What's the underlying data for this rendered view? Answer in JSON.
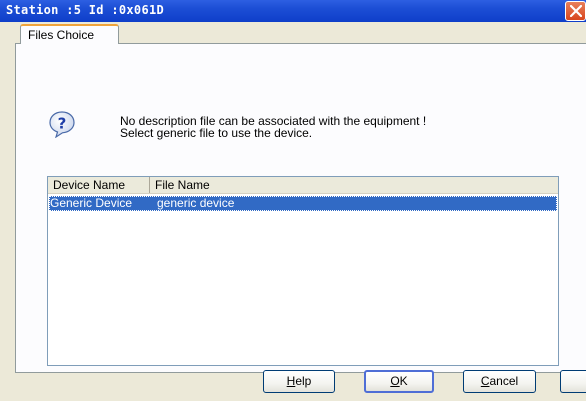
{
  "window": {
    "title": "Station :5 Id :0x061D"
  },
  "tabs": [
    {
      "label": "Files Choice"
    }
  ],
  "message": {
    "line1": "No description file can be associated with the equipment !",
    "line2": "Select generic file to use the device.",
    "icon": "question-icon"
  },
  "list": {
    "columns": [
      "Device Name",
      "File Name"
    ],
    "rows": [
      {
        "device_name": "Generic Device",
        "file_name": "generic device",
        "selected": true
      }
    ]
  },
  "buttons": {
    "help": {
      "prefix": "",
      "mnemonic": "H",
      "rest": "elp"
    },
    "ok": {
      "prefix": "",
      "mnemonic": "O",
      "rest": "K"
    },
    "cancel": {
      "prefix": "",
      "mnemonic": "C",
      "rest": "ancel"
    }
  },
  "colors": {
    "titlebar": "#0f3ec9",
    "selection": "#316ac5",
    "tab_accent": "#f0a33a"
  }
}
